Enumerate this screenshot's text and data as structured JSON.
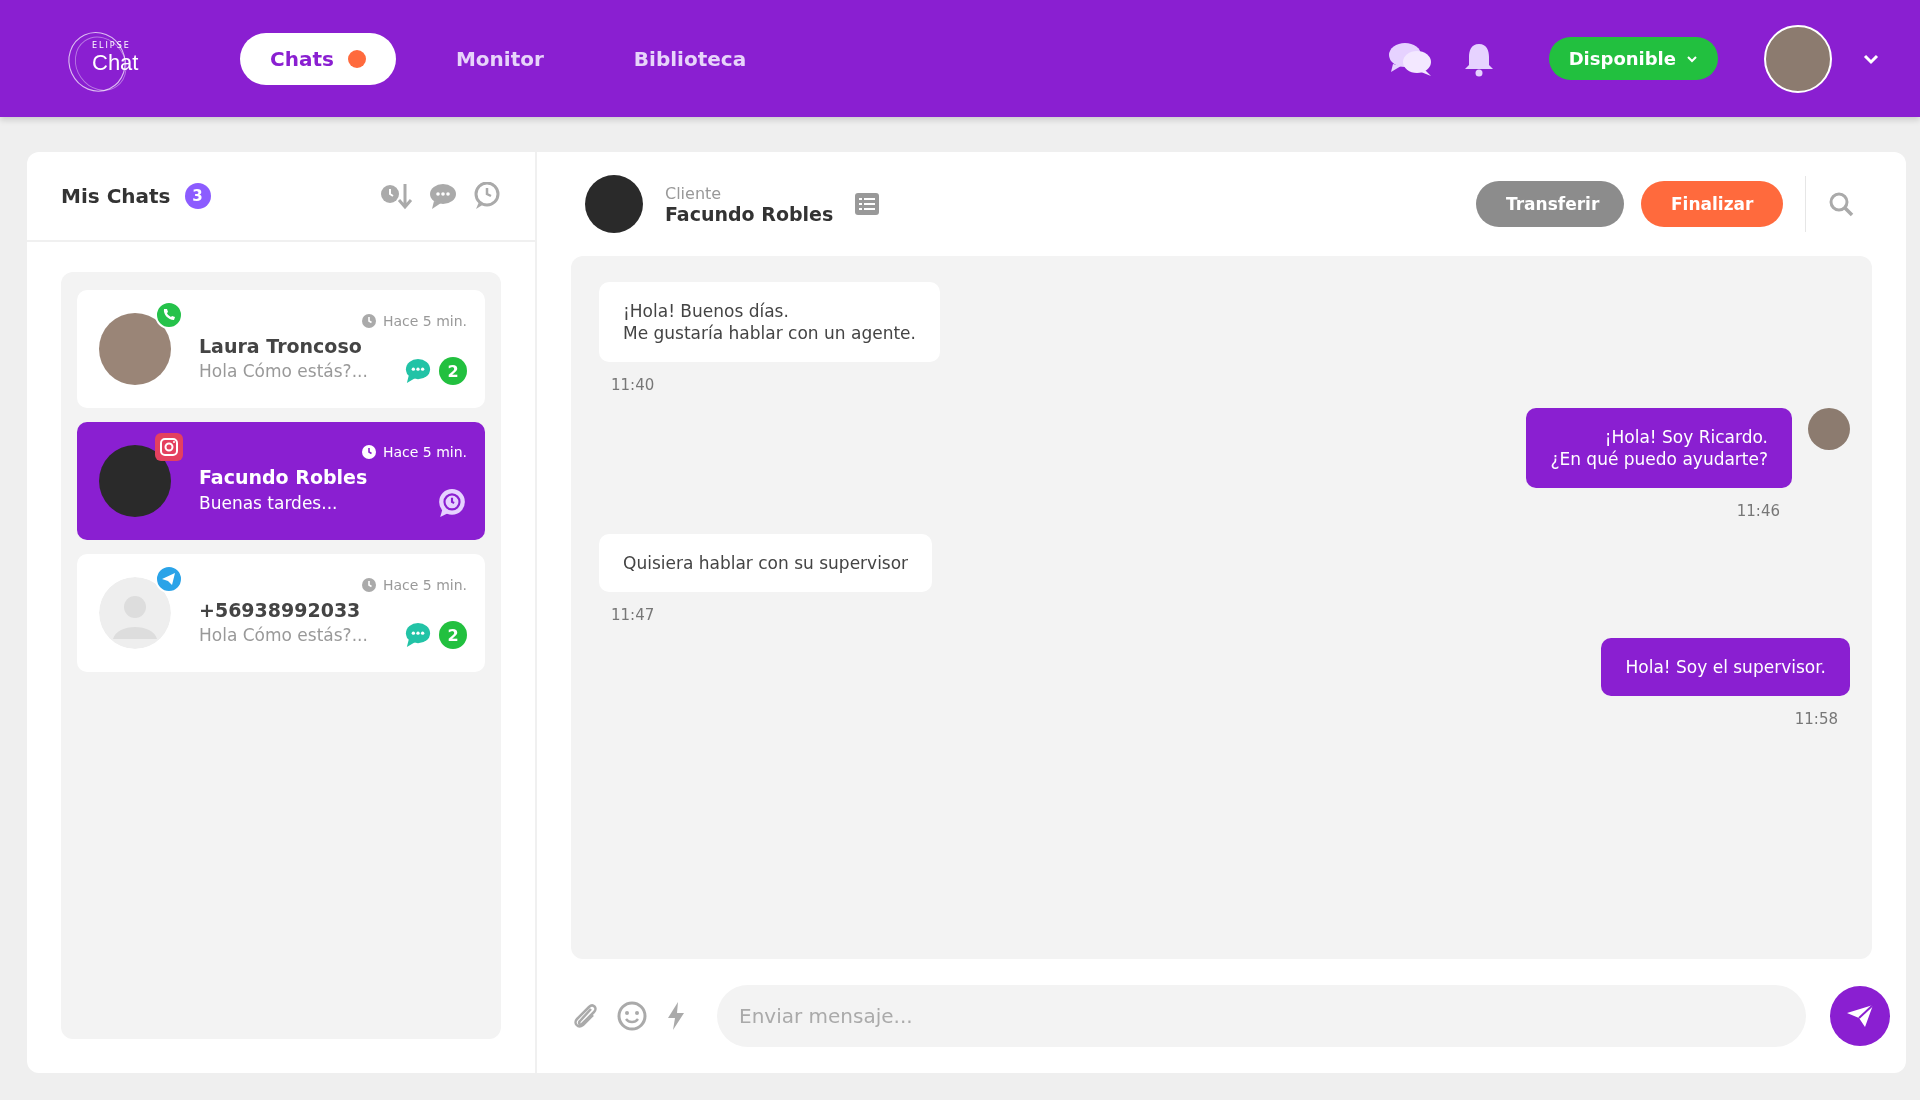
{
  "header": {
    "logo": {
      "overline": "ELIPSE",
      "wordmark": "Chat"
    },
    "nav": [
      {
        "label": "Chats",
        "selected": true,
        "dot": true
      },
      {
        "label": "Monitor",
        "selected": false,
        "dot": false
      },
      {
        "label": "Biblioteca",
        "selected": false,
        "dot": false
      }
    ],
    "status": "Disponible"
  },
  "sidebar": {
    "title": "Mis Chats",
    "count": "3",
    "chats": [
      {
        "name": "Laura Troncoso",
        "preview": "Hola Cómo estás?...",
        "time": "Hace 5 min.",
        "kind": "whatsapp",
        "photo": true,
        "selected": false,
        "waiting": false,
        "unread": "2"
      },
      {
        "name": "Facundo Robles",
        "preview": "Buenas tardes...",
        "time": "Hace 5 min.",
        "kind": "instagram",
        "photo": true,
        "selected": true,
        "waiting": true
      },
      {
        "name": "+56938992033",
        "preview": "Hola Cómo estás?...",
        "time": "Hace 5 min.",
        "kind": "telegram",
        "photo": false,
        "selected": false,
        "waiting": false,
        "unread": "2"
      }
    ]
  },
  "chat": {
    "contact_label": "Cliente",
    "contact_name": "Facundo Robles",
    "buttons": [
      {
        "label": "Transferir",
        "kind": "secondary"
      },
      {
        "label": "Finalizar",
        "kind": "primary"
      }
    ],
    "messages": [
      {
        "outgoing": false,
        "text": "¡Hola! Buenos días.\nMe gustaría hablar con un agente.",
        "time": "11:40",
        "avatar": false
      },
      {
        "outgoing": true,
        "text": "¡Hola! Soy Ricardo.\n¿En qué puedo ayudarte?",
        "time": "11:46",
        "avatar": true
      },
      {
        "outgoing": false,
        "text": "Quisiera hablar con su supervisor",
        "time": "11:47",
        "avatar": false
      },
      {
        "outgoing": true,
        "text": "Hola! Soy el supervisor.",
        "time": "11:58",
        "avatar": false
      }
    ],
    "input": {
      "placeholder": "Enviar mensaje..."
    }
  }
}
